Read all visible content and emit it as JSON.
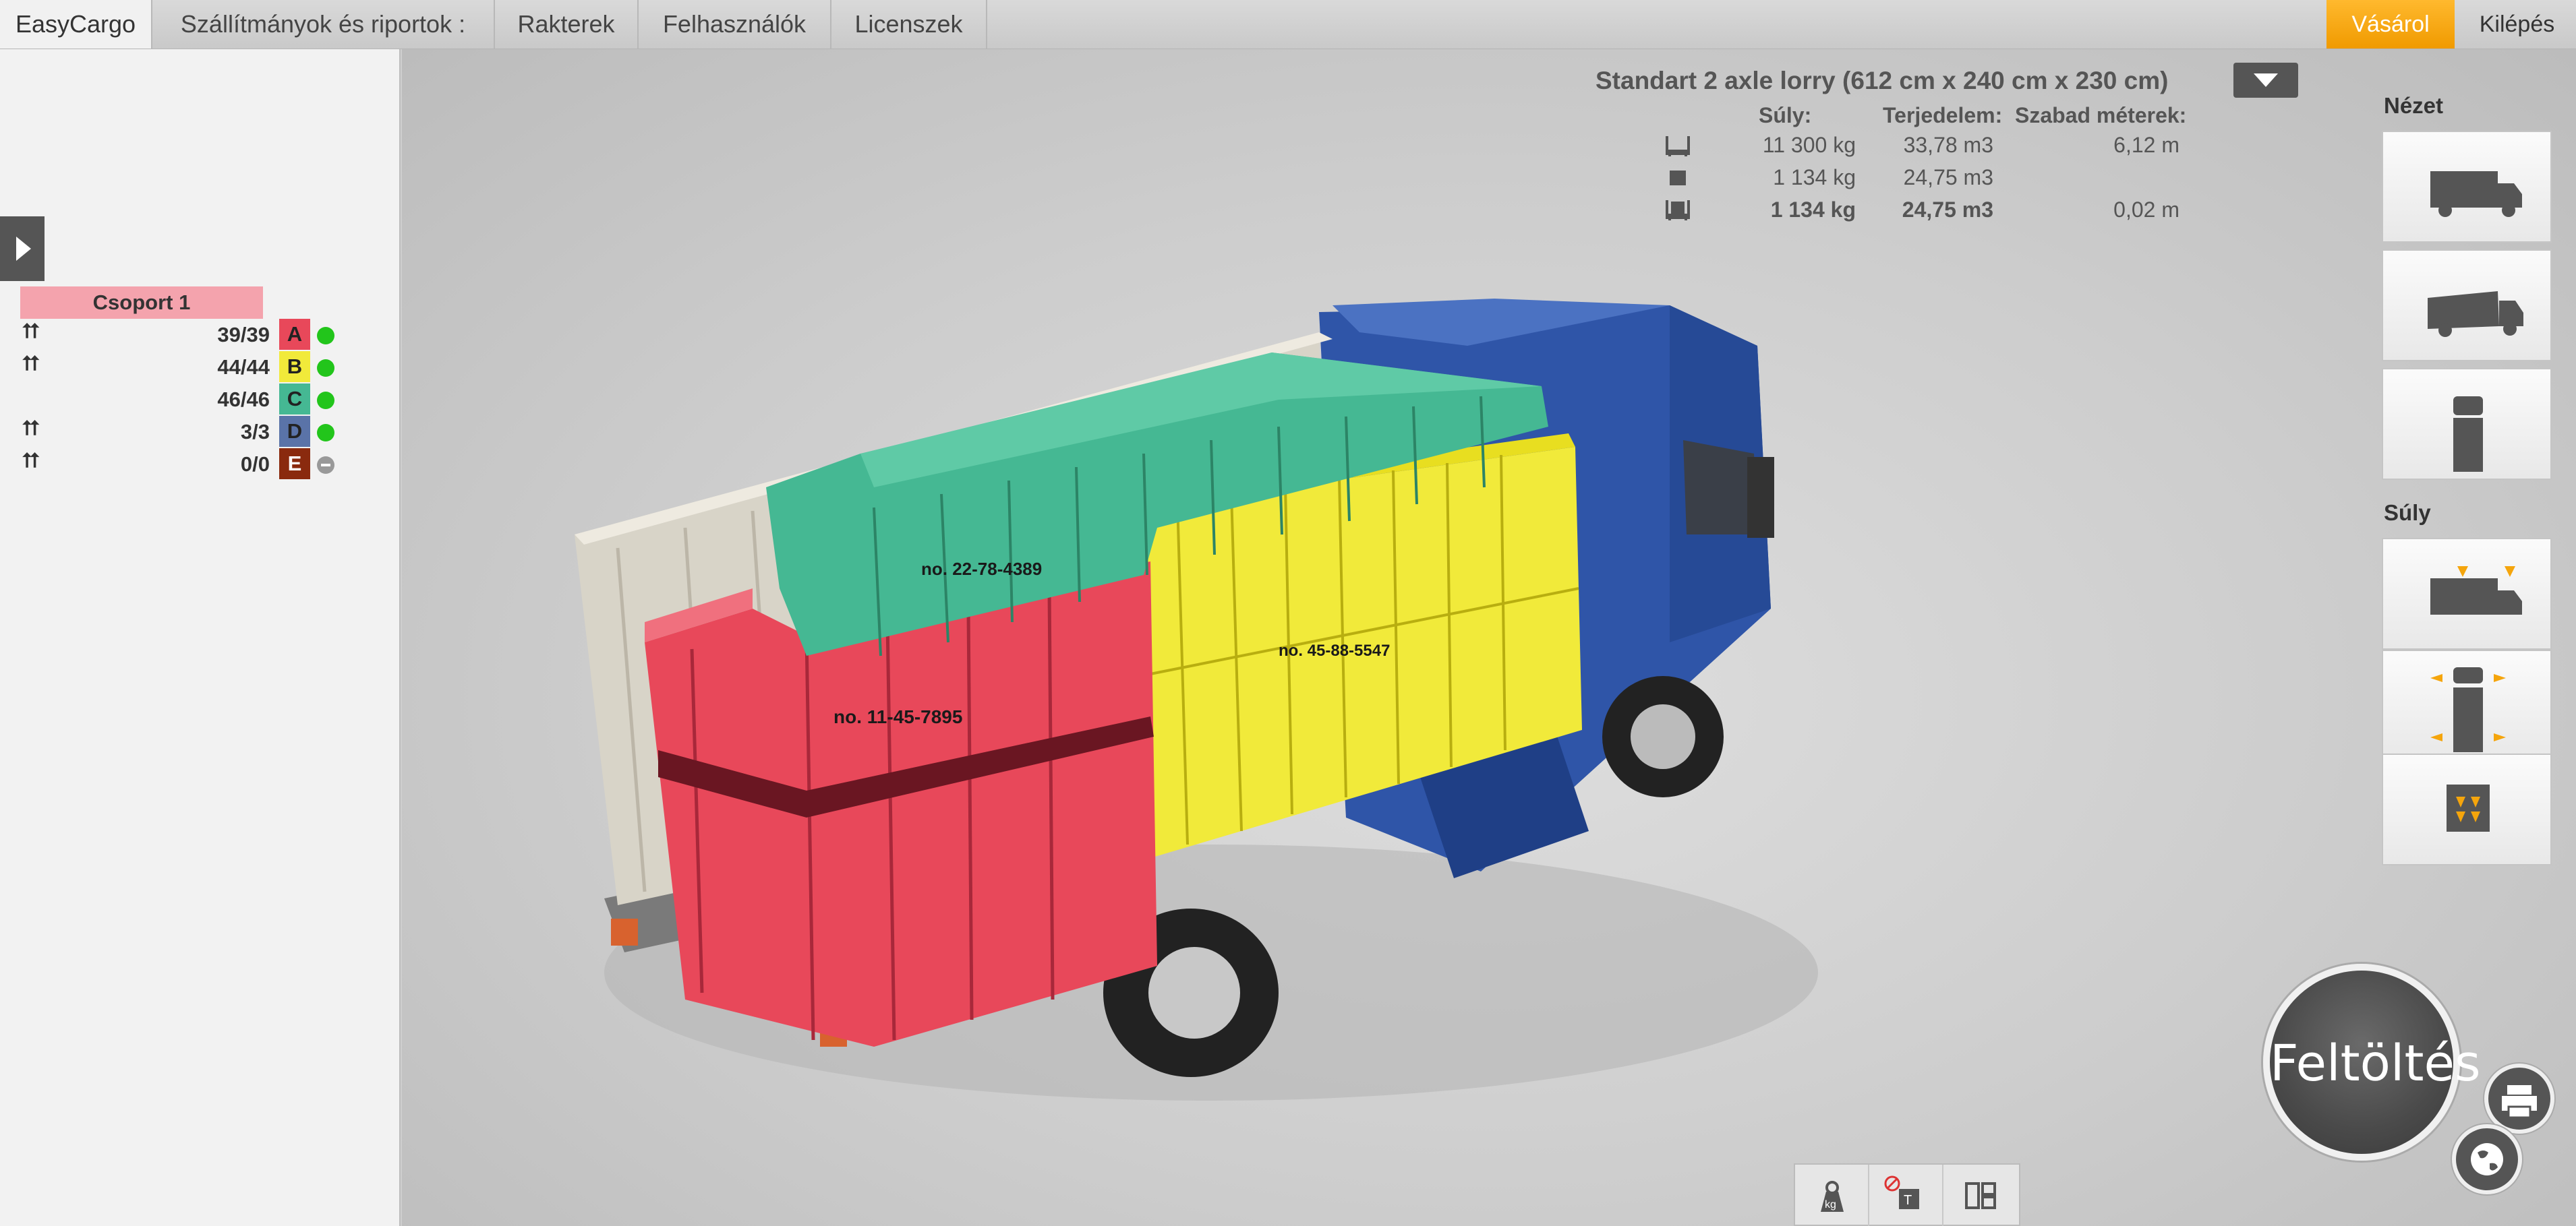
{
  "tabs": [
    {
      "label": "EasyCargo",
      "active": true
    },
    {
      "label": "Szállítmányok és riportok :",
      "active": false
    },
    {
      "label": "Rakterek",
      "active": false
    },
    {
      "label": "Felhasználók",
      "active": false
    },
    {
      "label": "Licenszek",
      "active": false
    }
  ],
  "header_actions": {
    "buy_label": "Vásárol",
    "exit_label": "Kilépés"
  },
  "left_panel": {
    "group_label": "Csoport 1",
    "rows": [
      {
        "stackable_icon": "⮅",
        "count": "39/39",
        "letter": "A",
        "color": "#e8485a",
        "status": "green"
      },
      {
        "stackable_icon": "⮅",
        "count": "44/44",
        "letter": "B",
        "color": "#f1ea3a",
        "status": "green"
      },
      {
        "stackable_icon": "",
        "count": "46/46",
        "letter": "C",
        "color": "#45b893",
        "status": "green"
      },
      {
        "stackable_icon": "⮅",
        "count": "3/3",
        "letter": "D",
        "color": "#5a73a8",
        "status": "green"
      },
      {
        "stackable_icon": "⮅",
        "count": "0/0",
        "letter": "E",
        "color": "#8a2a0e",
        "status": "none"
      }
    ]
  },
  "truck": {
    "title": "Standart 2 axle lorry (612 cm x 240 cm x 230 cm)",
    "stat_headers": {
      "weight": "Súly:",
      "volume": "Terjedelem:",
      "free_meters": "Szabad méterek:"
    },
    "rows": [
      {
        "icon": "pallet-capacity-icon",
        "weight": "11 300 kg",
        "volume": "33,78 m3",
        "free": "6,12 m",
        "bold": false
      },
      {
        "icon": "box-icon",
        "weight": "1 134 kg",
        "volume": "24,75 m3",
        "free": "",
        "bold": false
      },
      {
        "icon": "loaded-cart-icon",
        "weight": "1 134 kg",
        "volume": "24,75 m3",
        "free": "0,02 m",
        "bold": true
      }
    ]
  },
  "right_panel": {
    "view_label": "Nézet",
    "weight_label": "Súly"
  },
  "upload_label": "Feltöltés",
  "box_labels": {
    "a": "no. 11-45-7895",
    "b": "no. 45-88-5547",
    "c": "no. 22-78-4389"
  },
  "colors": {
    "accent": "#f5a50c",
    "red_cargo": "#e8485a",
    "yellow_cargo": "#f1ea3a",
    "green_cargo": "#45b893",
    "truck_blue": "#2f55a8",
    "status_green": "#22c51b"
  }
}
